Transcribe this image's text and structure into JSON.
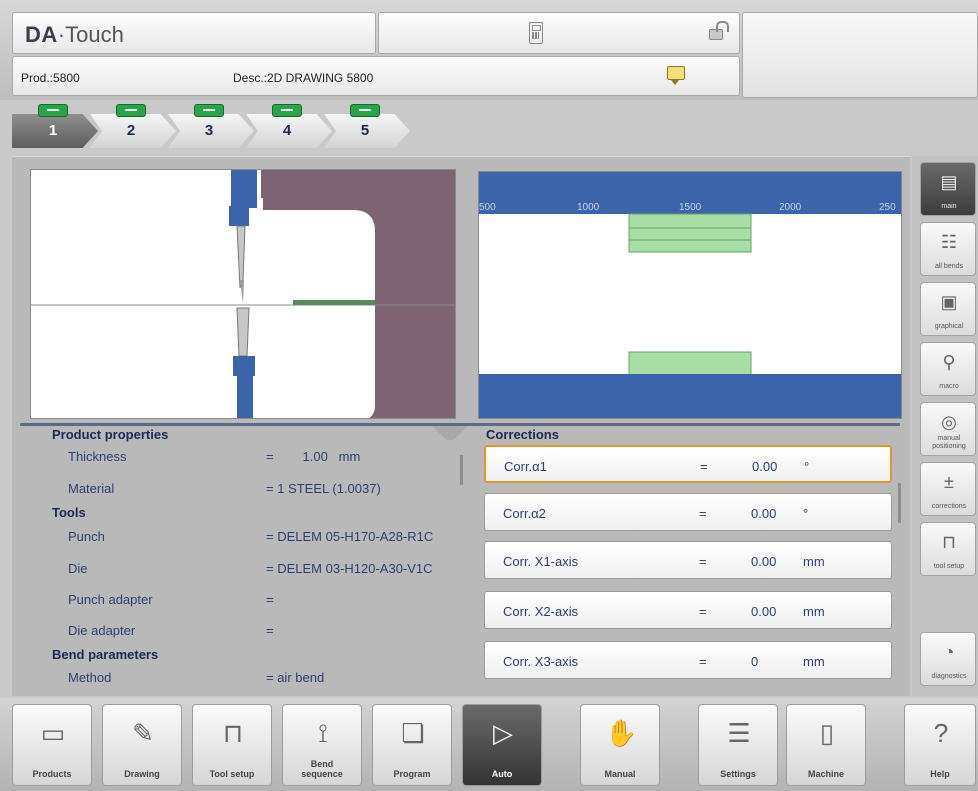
{
  "header": {
    "brand_prefix": "DA",
    "brand_suffix": "·Touch",
    "prod": "Prod.:5800",
    "desc": "Desc.:2D DRAWING 5800"
  },
  "icons": {
    "calculator": "calculator-icon",
    "lock": "unlocked-padlock-icon",
    "note": "note-icon"
  },
  "bend_steps": [
    "1",
    "2",
    "3",
    "4",
    "5"
  ],
  "scale_ticks": [
    "500",
    "1000",
    "1500",
    "2000",
    "250"
  ],
  "product_properties": {
    "title": "Product properties",
    "thickness_label": "Thickness",
    "thickness_eq": "=",
    "thickness_value": "1.00",
    "thickness_unit": "mm",
    "material_label": "Material",
    "material_value": "= 1 STEEL (1.0037)",
    "tools_title": "Tools",
    "punch_label": "Punch",
    "punch_value": "= DELEM 05-H170-A28-R1C",
    "die_label": "Die",
    "die_value": "= DELEM 03-H120-A30-V1C",
    "punch_adapter_label": "Punch adapter",
    "punch_adapter_value": "=",
    "die_adapter_label": "Die adapter",
    "die_adapter_value": "=",
    "bend_params_title": "Bend parameters",
    "method_label": "Method",
    "method_value": "= air bend"
  },
  "corrections": {
    "title": "Corrections",
    "rows": [
      {
        "label": "Corr.α1",
        "eq": "=",
        "value": "0.00",
        "unit": "°"
      },
      {
        "label": "Corr.α2",
        "eq": "=",
        "value": "0.00",
        "unit": "°"
      },
      {
        "label": "Corr. X1-axis",
        "eq": "=",
        "value": "0.00",
        "unit": "mm"
      },
      {
        "label": "Corr. X2-axis",
        "eq": "=",
        "value": "0.00",
        "unit": "mm"
      },
      {
        "label": "Corr. X3-axis",
        "eq": "=",
        "value": "0",
        "unit": "mm"
      }
    ]
  },
  "side_buttons": {
    "main": "main",
    "all_bends": "all bends",
    "graphical": "graphical",
    "macro": "macro",
    "manual_positioning": "manual positioning",
    "corrections": "corrections",
    "tool_setup": "tool setup",
    "diagnostics": "diagnostics"
  },
  "nav": {
    "products": "Products",
    "drawing": "Drawing",
    "tool_setup": "Tool setup",
    "bend_sequence_1": "Bend",
    "bend_sequence_2": "sequence",
    "program": "Program",
    "auto": "Auto",
    "manual": "Manual",
    "settings": "Settings",
    "machine": "Machine",
    "help": "Help"
  },
  "colors": {
    "tool_blue": "#3c64aa",
    "profile_purple": "#7e6472",
    "sheet_green": "#a6dea6",
    "active_border": "#e39a24",
    "step_green": "#2aa44a"
  }
}
